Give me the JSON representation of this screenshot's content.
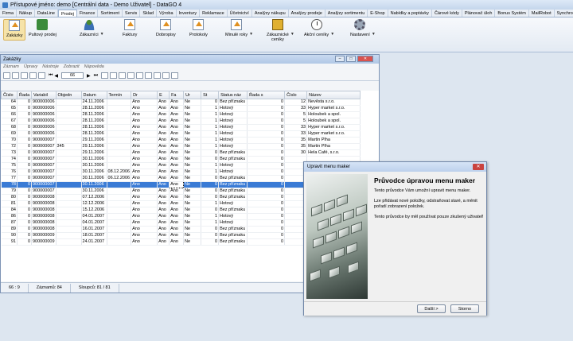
{
  "app": {
    "title": "Přístupové jméno: demo [Centrální data - Demo Uživatel] - DataGO 4"
  },
  "menu": [
    "Firma",
    "Nákup",
    "DataLine",
    "Prodej",
    "Finance",
    "Sortiment",
    "Servis",
    "Sklad",
    "Výroba",
    "Inventury",
    "Reklamace",
    "Účetnictví",
    "Analýzy nákupu",
    "Analýzy prodeje",
    "Analýzy sortimentu",
    "E-Shop",
    "Nabídky a poptávky",
    "Čárové kódy",
    "Plánovač úloh",
    "Bonus Systém",
    "MailRobot",
    "Synchronizace",
    "Odes"
  ],
  "ribbon": {
    "zakazky": "Zakázky",
    "pultovy_prodej": "Pultový prodej",
    "zakaznici": "Zákazníci",
    "faktury": "Faktury",
    "dobropisy": "Dobropisy",
    "protokoly": "Protokoly",
    "minule_roky": "Minulé roky",
    "zakaznicke_ceniky_1": "Zákaznické",
    "zakaznicke_ceniky_2": "ceníky",
    "akcni_ceniky": "Akční ceníky",
    "nastaveni": "Nastavení"
  },
  "window": {
    "title": "Zakázky",
    "menu": [
      "Záznam",
      "Úpravy",
      "Nástroje",
      "Zobrazit",
      "Nápověda"
    ],
    "page": "66",
    "columns": [
      "Číslo",
      "Řada",
      "Variabil",
      "Objedn",
      "Datum",
      "Termín",
      "Dr",
      "E",
      "Fa",
      "Ur",
      "St",
      "Status náz",
      "Řada s",
      "Číslo",
      "Název"
    ],
    "rows": [
      [
        "64",
        "0",
        "900000006",
        "",
        "24.11.2006",
        "",
        "Ano",
        "Ano",
        "Ano",
        "Ne",
        "0",
        "Bez příznaku",
        "0",
        "12",
        "Nevěsta s.r.o."
      ],
      [
        "65",
        "0",
        "900000006",
        "",
        "28.11.2006",
        "",
        "Ano",
        "Ano",
        "Ano",
        "Ne",
        "1",
        "Hotový",
        "0",
        "33",
        "Hyper market s.r.o."
      ],
      [
        "66",
        "0",
        "900000006",
        "",
        "28.11.2006",
        "",
        "Ano",
        "Ano",
        "Ano",
        "Ne",
        "1",
        "Hotový",
        "0",
        "5",
        "Holoubek a spol."
      ],
      [
        "67",
        "0",
        "900000006",
        "",
        "28.11.2006",
        "",
        "Ano",
        "Ano",
        "Ano",
        "Ne",
        "1",
        "Hotový",
        "0",
        "5",
        "Holoubek a spol."
      ],
      [
        "68",
        "0",
        "900000006",
        "",
        "28.11.2006",
        "",
        "Ano",
        "Ano",
        "Ano",
        "Ne",
        "1",
        "Hotový",
        "0",
        "33",
        "Hyper market s.r.o."
      ],
      [
        "69",
        "0",
        "900000006",
        "",
        "28.11.2006",
        "",
        "Ano",
        "Ano",
        "Ano",
        "Ne",
        "1",
        "Hotový",
        "0",
        "33",
        "Hyper market s.r.o."
      ],
      [
        "70",
        "0",
        "900000007",
        "",
        "29.11.2006",
        "",
        "Ano",
        "Ano",
        "Ano",
        "Ne",
        "1",
        "Hotový",
        "0",
        "35",
        "Martin Plha"
      ],
      [
        "72",
        "0",
        "900000007",
        "345",
        "29.11.2006",
        "",
        "Ano",
        "Ano",
        "Ano",
        "Ne",
        "1",
        "Hotový",
        "0",
        "35",
        "Martin Plha"
      ],
      [
        "73",
        "0",
        "900000007",
        "",
        "29.11.2006",
        "",
        "Ano",
        "Ano",
        "Ano",
        "Ne",
        "0",
        "Bez příznaku",
        "0",
        "30",
        "Hela Café, s.r.o."
      ],
      [
        "74",
        "0",
        "900000007",
        "",
        "30.11.2006",
        "",
        "Ano",
        "Ano",
        "Ano",
        "Ne",
        "0",
        "Bez příznaku",
        "0",
        "",
        ""
      ],
      [
        "75",
        "0",
        "900000007",
        "",
        "30.11.2006",
        "",
        "Ano",
        "Ano",
        "Ano",
        "Ne",
        "1",
        "Hotový",
        "0",
        "",
        ""
      ],
      [
        "76",
        "0",
        "900000007",
        "",
        "30.11.2006",
        "08.12.2006",
        "Ano",
        "Ano",
        "Ano",
        "Ne",
        "1",
        "Hotový",
        "0",
        "",
        ""
      ],
      [
        "77",
        "0",
        "900000007",
        "",
        "30.11.2006",
        "06.12.2006",
        "Ano",
        "Ano",
        "Ano",
        "Ne",
        "0",
        "Bez příznaku",
        "0",
        "",
        ""
      ],
      [
        "78",
        "0",
        "900000007",
        "",
        "30.11.2006",
        "",
        "Ano",
        "Ano",
        "Ano",
        "Ne",
        "0",
        "Bez příznaku",
        "0",
        "",
        ""
      ],
      [
        "79",
        "0",
        "900000007",
        "",
        "30.11.2006",
        "",
        "Ano",
        "Ano",
        "Ano",
        "Ne",
        "0",
        "Bez příznaku",
        "0",
        "",
        ""
      ],
      [
        "80",
        "0",
        "900000008",
        "",
        "07.12.2006",
        "",
        "Ano",
        "Ano",
        "Ano",
        "Ne",
        "0",
        "Bez příznaku",
        "0",
        "",
        ""
      ],
      [
        "81",
        "0",
        "900000008",
        "",
        "12.12.2006",
        "",
        "Ano",
        "Ano",
        "Ano",
        "Ne",
        "1",
        "Hotový",
        "0",
        "",
        ""
      ],
      [
        "84",
        "0",
        "900000008",
        "",
        "15.12.2006",
        "",
        "Ano",
        "Ano",
        "Ano",
        "Ne",
        "0",
        "Bez příznaku",
        "0",
        "",
        ""
      ],
      [
        "86",
        "0",
        "900000008",
        "",
        "04.01.2007",
        "",
        "Ano",
        "Ano",
        "Ano",
        "Ne",
        "1",
        "Hotový",
        "0",
        "",
        ""
      ],
      [
        "87",
        "0",
        "900000008",
        "",
        "04.01.2007",
        "",
        "Ano",
        "Ano",
        "Ano",
        "Ne",
        "1",
        "Hotový",
        "0",
        "",
        ""
      ],
      [
        "89",
        "0",
        "900000008",
        "",
        "16.01.2007",
        "",
        "Ano",
        "Ano",
        "Ano",
        "Ne",
        "0",
        "Bez příznaku",
        "0",
        "",
        ""
      ],
      [
        "90",
        "0",
        "900000009",
        "",
        "18.01.2007",
        "",
        "Ano",
        "Ano",
        "Ano",
        "Ne",
        "0",
        "Bez příznaku",
        "0",
        "",
        ""
      ],
      [
        "91",
        "0",
        "900000009",
        "",
        "24.01.2007",
        "",
        "Ano",
        "Ano",
        "Ano",
        "Ne",
        "0",
        "Bez příznaku",
        "0",
        "",
        ""
      ]
    ],
    "selected_index": 13,
    "status": {
      "pos": "66 : 9",
      "records": "Záznamů: 84",
      "cols": "Sloupců: 81 / 81"
    }
  },
  "dialog": {
    "title": "Upravit menu maker",
    "heading": "Průvodce úpravou menu maker",
    "p1": "Tento průvodce Vám umožní upravit menu maker.",
    "p2": "Lze přidávat nové položky, odstraňovat staré, a měnit pořadí zobrazení položek.",
    "p3": "Tento průvodce by měl používat pouze zkušený uživatel!",
    "next": "Další >",
    "cancel": "Storno"
  }
}
